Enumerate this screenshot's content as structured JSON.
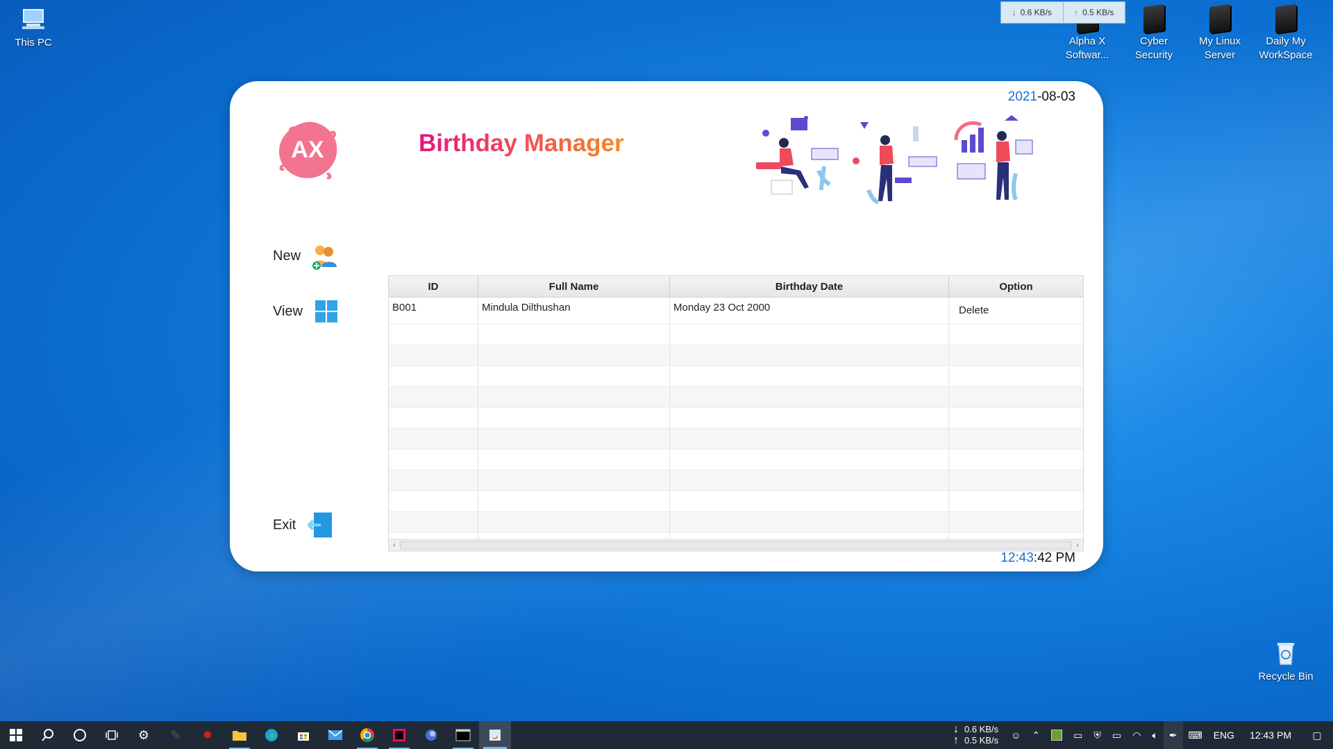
{
  "desktop": {
    "icons": [
      {
        "label": "This PC"
      },
      {
        "label": "Alpha X Softwar..."
      },
      {
        "label": "Cyber Security"
      },
      {
        "label": "My Linux Server"
      },
      {
        "label": "Daily My WorkSpace"
      },
      {
        "label": "Recycle Bin"
      }
    ]
  },
  "net_widget": {
    "download": "0.6 KB/s",
    "upload": "0.5 KB/s"
  },
  "app": {
    "date_year": "2021",
    "date_rest": "-08-03",
    "title_part1": "Birthday",
    "title_part2": "Manager",
    "logo_text": "AX",
    "menu": {
      "new": "New",
      "view": "View",
      "exit": "Exit"
    },
    "table": {
      "headers": [
        "ID",
        "Full Name",
        "Birthday Date",
        "Option"
      ],
      "rows": [
        {
          "id": "B001",
          "name": "Mindula Dilthushan",
          "birthday": "Monday 23 Oct 2000",
          "option": "Delete"
        }
      ]
    },
    "time_hm": "12:43",
    "time_rest": ":42 PM"
  },
  "taskbar": {
    "net_down": "0.6 KB/s",
    "net_up": "0.5 KB/s",
    "language": "ENG",
    "clock": "12:43 PM"
  },
  "colors": {
    "accent": "#1a6fd6",
    "title_start": "#e3157f",
    "title_end": "#f58a24",
    "taskbar": "#1f2a36"
  }
}
